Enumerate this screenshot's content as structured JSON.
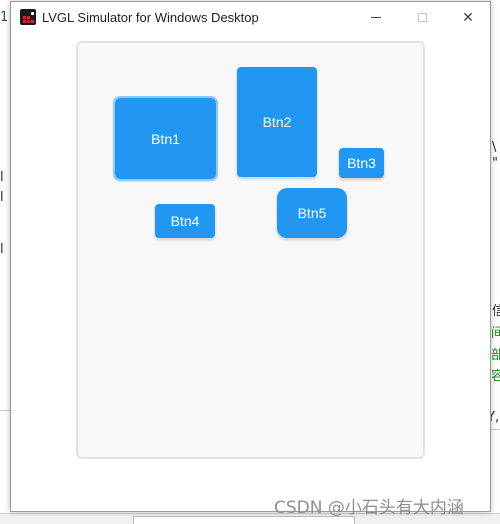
{
  "window": {
    "title": "LVGL Simulator for Windows Desktop",
    "controls": {
      "close_glyph": "✕"
    }
  },
  "buttons": [
    {
      "label": "Btn1"
    },
    {
      "label": "Btn2"
    },
    {
      "label": "Btn3"
    },
    {
      "label": "Btn4"
    },
    {
      "label": "Btn5"
    }
  ],
  "colors": {
    "button": "#2196f3",
    "button_text": "#ffffff",
    "focus_outline": "#90c8f7",
    "container_bg": "#f8f8f8"
  },
  "watermark": "CSDN @小石头有大内涵",
  "background": {
    "left_glyphs": [
      "1",
      "l",
      "l",
      "l"
    ],
    "right_glyphs": [
      "\\",
      "\"",
      "信",
      "间",
      "部",
      "容",
      "Y,"
    ]
  }
}
